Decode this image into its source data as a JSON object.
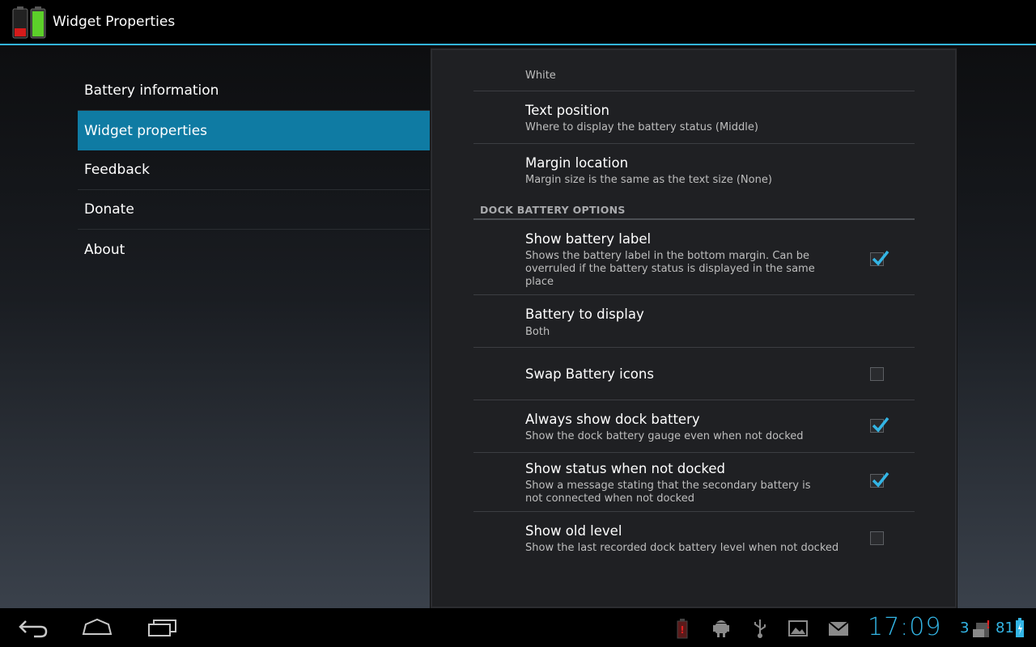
{
  "app": {
    "title": "Widget Properties"
  },
  "headers": [
    {
      "label": "Battery information",
      "selected": false
    },
    {
      "label": "Widget properties",
      "selected": true
    },
    {
      "label": "Feedback",
      "selected": false
    },
    {
      "label": "Donate",
      "selected": false
    },
    {
      "label": "About",
      "selected": false
    }
  ],
  "prefs": {
    "cut_off_summary": "White",
    "text_position": {
      "title": "Text position",
      "summary": "Where to display the battery status (Middle)"
    },
    "margin_location": {
      "title": "Margin location",
      "summary": "Margin size is the same as the text size (None)"
    },
    "category": "DOCK BATTERY OPTIONS",
    "show_battery_label": {
      "title": "Show battery label",
      "summary": "Shows the battery label in the bottom margin. Can be overruled if the battery status is displayed in the same place",
      "checked": true
    },
    "battery_to_display": {
      "title": "Battery to display",
      "summary": "Both"
    },
    "swap_battery_icons": {
      "title": "Swap Battery icons",
      "checked": false
    },
    "always_show_dock": {
      "title": "Always show dock battery",
      "summary": "Show the dock battery gauge even when not docked",
      "checked": true
    },
    "show_status_not_docked": {
      "title": "Show status when not docked",
      "summary": "Show a message stating that the secondary battery is not connected when not docked",
      "checked": true
    },
    "show_old_level": {
      "title": "Show old level",
      "summary": "Show the last recorded dock battery level when not docked",
      "checked": false
    }
  },
  "system_bar": {
    "clock": "17:09",
    "notification_count": "3",
    "battery_level": "81"
  },
  "colors": {
    "accent": "#33b5e5",
    "selected_header": "#0f7ba3"
  }
}
